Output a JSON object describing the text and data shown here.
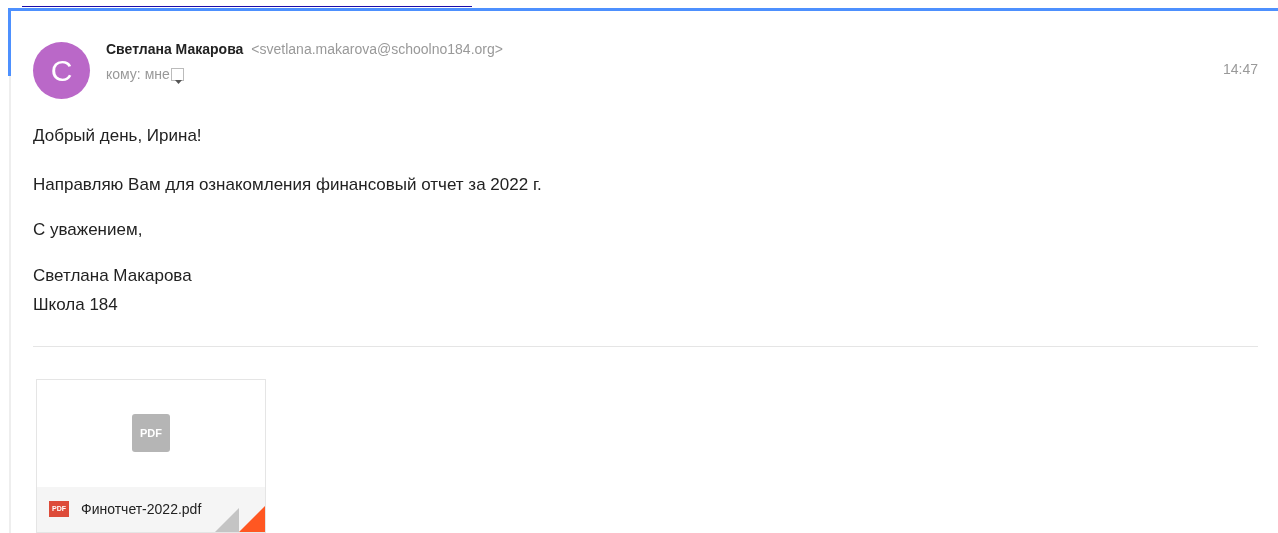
{
  "message": {
    "sender_name": "Светлана Макарова",
    "sender_email": "<svetlana.makarova@schoolno184.org>",
    "avatar_letter": "С",
    "recipient": "кому: мне",
    "time": "14:47"
  },
  "body": [
    "Добрый день, Ирина!",
    "Направляю Вам для ознакомления финансовый отчет за 2022 г.",
    "С уважением,"
  ],
  "signature": [
    "Светлана Макарова",
    "Школа 184"
  ],
  "attachments": [
    {
      "preview_label": "PDF",
      "type_label": "PDF",
      "filename": "Финотчет-2022.pdf"
    }
  ]
}
